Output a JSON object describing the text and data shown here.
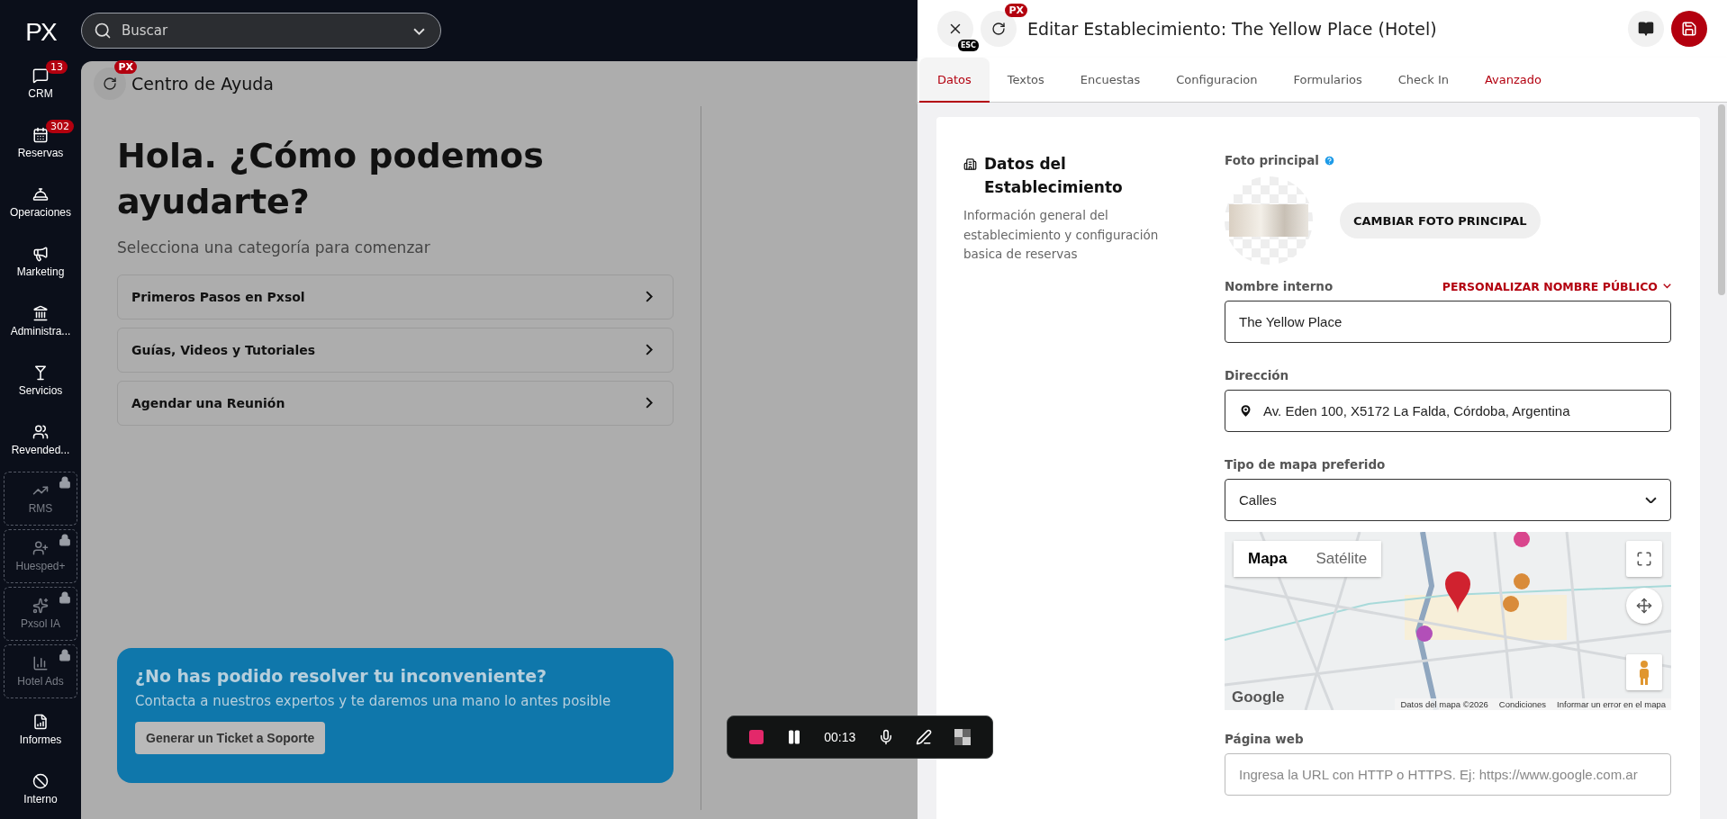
{
  "sidebar": {
    "logo": "PX",
    "items": [
      {
        "label": "CRM",
        "badge": "13",
        "locked": false
      },
      {
        "label": "Reservas",
        "badge": "302",
        "locked": false
      },
      {
        "label": "Operaciones",
        "locked": false
      },
      {
        "label": "Marketing",
        "locked": false
      },
      {
        "label": "Administra...",
        "locked": false
      },
      {
        "label": "Servicios",
        "locked": false
      },
      {
        "label": "Revended...",
        "locked": false
      },
      {
        "label": "RMS",
        "locked": true
      },
      {
        "label": "Huesped+",
        "locked": true
      },
      {
        "label": "Pxsol IA",
        "locked": true
      },
      {
        "label": "Hotel Ads",
        "locked": true
      },
      {
        "label": "Informes",
        "locked": false
      },
      {
        "label": "Interno",
        "locked": false
      }
    ]
  },
  "search": {
    "placeholder": "Buscar"
  },
  "help_center": {
    "title": "Centro de Ayuda",
    "title_badge": "PX",
    "heading": "Hola. ¿Cómo podemos ayudarte?",
    "subtitle": "Selecciona una categoría para comenzar",
    "categories": [
      "Primeros Pasos en Pxsol",
      "Guías, Videos y Tutoriales",
      "Agendar una Reunión"
    ],
    "support_card": {
      "title": "¿No has podido resolver tu inconveniente?",
      "text": "Contacta a nuestros expertos y te daremos una mano lo antes posible",
      "button": "Generar un Ticket a Soporte"
    }
  },
  "recorder": {
    "time": "00:13"
  },
  "editor": {
    "close_hint": "ESC",
    "refresh_badge": "PX",
    "title": "Editar Establecimiento: The Yellow Place (Hotel)",
    "tabs": [
      {
        "label": "Datos",
        "selected": true,
        "hovered": false
      },
      {
        "label": "Textos",
        "selected": false,
        "hovered": false
      },
      {
        "label": "Encuestas",
        "selected": false,
        "hovered": false
      },
      {
        "label": "Configuracion",
        "selected": false,
        "hovered": false
      },
      {
        "label": "Formularios",
        "selected": false,
        "hovered": false
      },
      {
        "label": "Check In",
        "selected": false,
        "hovered": false
      },
      {
        "label": "Avanzado",
        "selected": false,
        "hovered": true
      }
    ],
    "section": {
      "title": "Datos del Establecimiento",
      "description": "Información general del establecimiento y configuración basica de reservas"
    },
    "photo": {
      "label": "Foto principal",
      "button": "CAMBIAR FOTO PRINCIPAL"
    },
    "internal_name": {
      "label": "Nombre interno",
      "link": "PERSONALIZAR NOMBRE PÚBLICO",
      "value": "The Yellow Place"
    },
    "address": {
      "label": "Dirección",
      "value": "Av. Eden 100, X5172 La Falda, Córdoba, Argentina"
    },
    "map_type": {
      "label": "Tipo de mapa preferido",
      "value": "Calles"
    },
    "map": {
      "types": [
        {
          "label": "Mapa",
          "selected": true
        },
        {
          "label": "Satélite",
          "selected": false
        }
      ],
      "logo": "Google",
      "attribution": [
        "Datos del mapa ©2026",
        "Condiciones",
        "Informar un error en el mapa"
      ]
    },
    "website": {
      "label": "Página web",
      "placeholder": "Ingresa la URL con HTTP o HTTPS. Ej: https://www.google.com.ar"
    }
  }
}
